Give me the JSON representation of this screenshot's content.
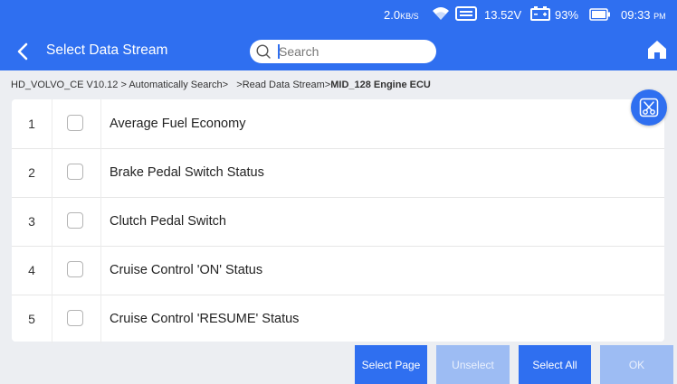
{
  "status_bar": {
    "net_speed": "2.0",
    "net_unit": "KB/S",
    "voltage": "13.52V",
    "battery": "93%",
    "time": "09:33",
    "ampm": "PM"
  },
  "header": {
    "title": "Select Data Stream",
    "search_placeholder": "Search"
  },
  "breadcrumb": {
    "path": "HD_VOLVO_CE V10.12 > Automatically Search>",
    "sub": ">Read Data Stream>",
    "current": "MID_128 Engine ECU"
  },
  "rows": [
    {
      "num": "1",
      "name": "Average Fuel Economy"
    },
    {
      "num": "2",
      "name": "Brake Pedal Switch Status"
    },
    {
      "num": "3",
      "name": "Clutch Pedal Switch"
    },
    {
      "num": "4",
      "name": "Cruise Control 'ON' Status"
    },
    {
      "num": "5",
      "name": "Cruise Control 'RESUME' Status"
    }
  ],
  "buttons": {
    "select_page": "Select Page",
    "unselect": "Unselect",
    "select_all": "Select All",
    "ok": "OK"
  },
  "colors": {
    "accent": "#2f6ff0",
    "disabled": "#9dbcf3"
  }
}
